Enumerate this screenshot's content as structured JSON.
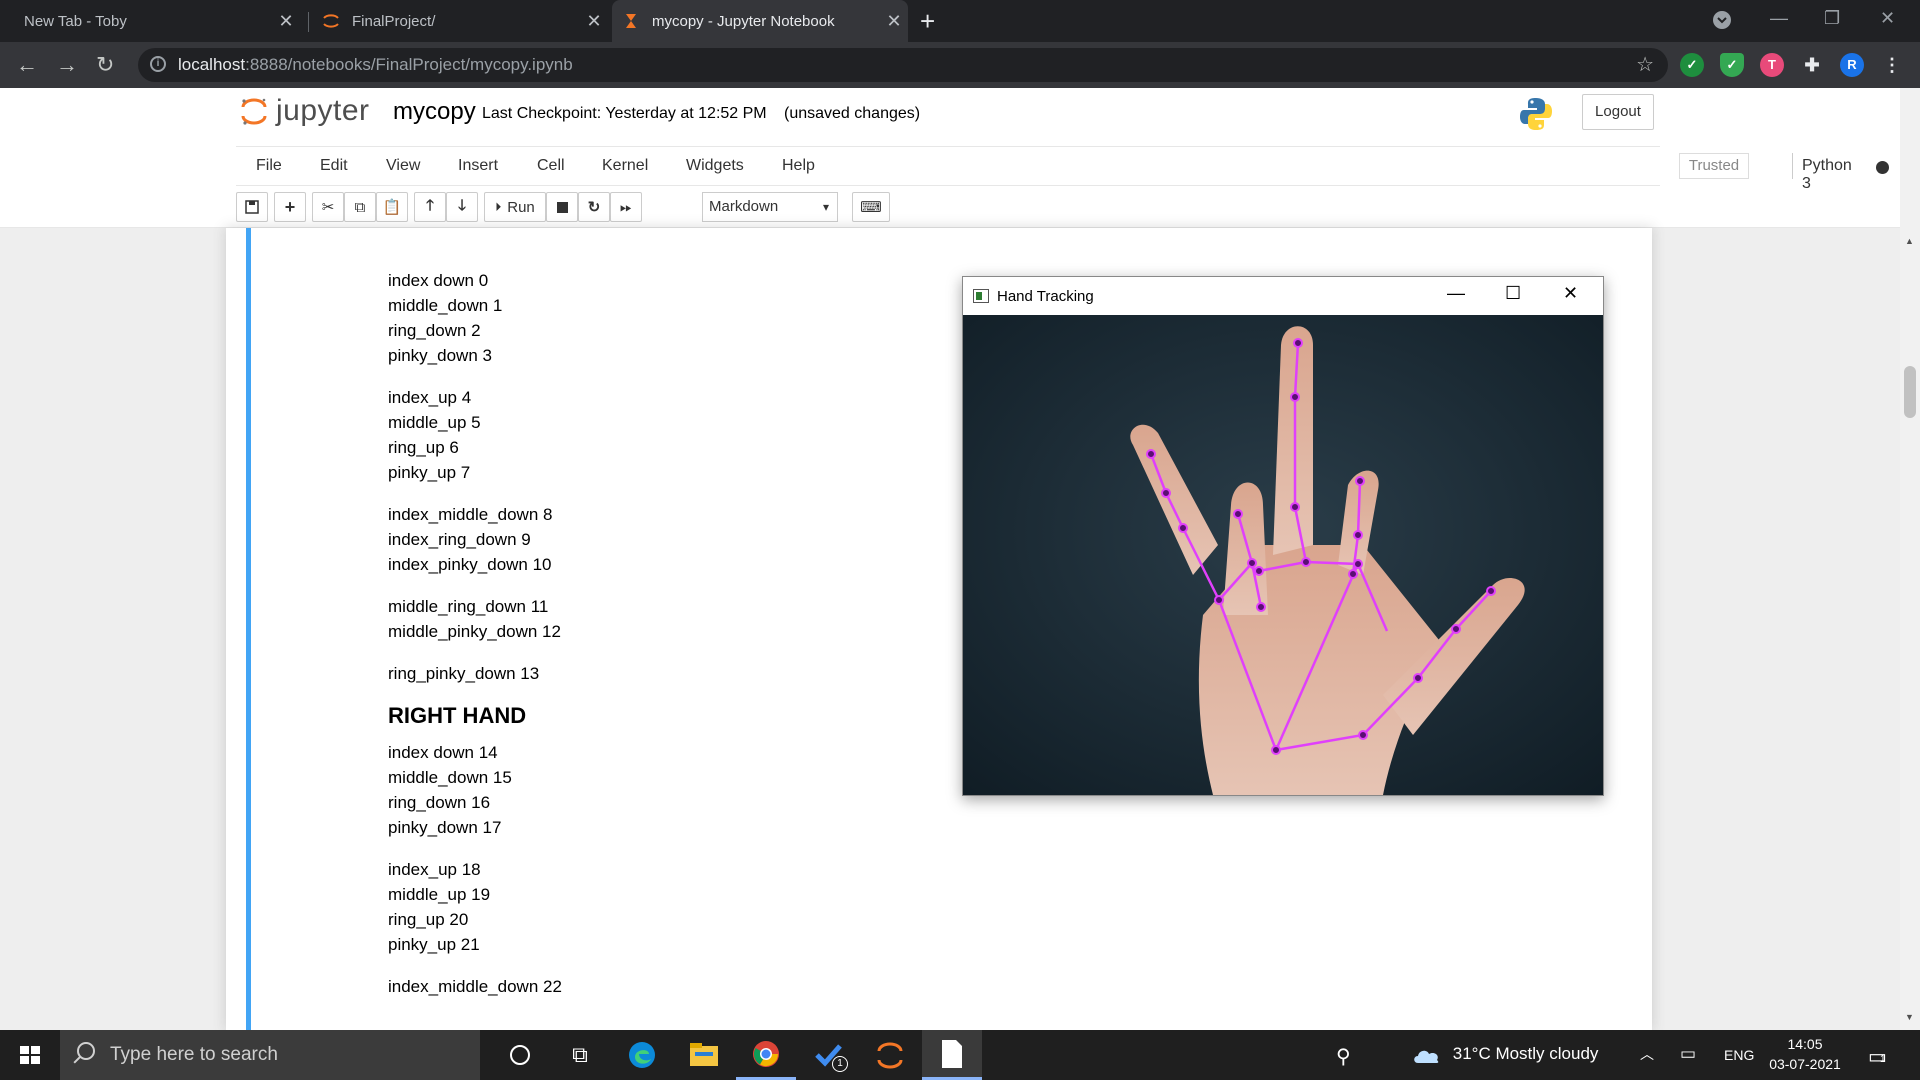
{
  "browser": {
    "tabs": [
      {
        "title": "New Tab - Toby",
        "active": false
      },
      {
        "title": "FinalProject/",
        "active": false
      },
      {
        "title": "mycopy - Jupyter Notebook",
        "active": true
      }
    ],
    "url_host": "localhost",
    "url_path": ":8888/notebooks/FinalProject/mycopy.ipynb",
    "profile_initial": "R",
    "ext_t_label": "T"
  },
  "jupyter": {
    "logo_text": "jupyter",
    "notebook_name": "mycopy",
    "checkpoint": "Last Checkpoint: Yesterday at 12:52 PM",
    "unsaved": "(unsaved changes)",
    "logout_label": "Logout",
    "menu": [
      "File",
      "Edit",
      "View",
      "Insert",
      "Cell",
      "Kernel",
      "Widgets",
      "Help"
    ],
    "trusted_label": "Trusted",
    "kernel_name": "Python 3",
    "toolbar": {
      "run_label": "Run",
      "cell_type": "Markdown"
    }
  },
  "cell": {
    "groups": [
      [
        "index down 0",
        "middle_down 1",
        "ring_down 2",
        "pinky_down 3"
      ],
      [
        "index_up 4",
        "middle_up 5",
        "ring_up 6",
        "pinky_up 7"
      ],
      [
        "index_middle_down 8",
        "index_ring_down 9",
        "index_pinky_down 10"
      ],
      [
        "middle_ring_down 11",
        "middle_pinky_down 12"
      ],
      [
        "ring_pinky_down 13"
      ]
    ],
    "heading": "RIGHT HAND",
    "groups2": [
      [
        "index down 14",
        "middle_down 15",
        "ring_down 16",
        "pinky_down 17"
      ],
      [
        "index_up 18",
        "middle_up 19",
        "ring_up 20",
        "pinky_up 21"
      ],
      [
        "index_middle_down 22"
      ]
    ]
  },
  "hand_window": {
    "title": "Hand Tracking",
    "landmark_color": "#e040fb"
  },
  "taskbar": {
    "search_placeholder": "Type here to search",
    "weather": "31°C  Mostly cloudy",
    "language": "ENG",
    "time": "14:05",
    "date": "03-07-2021",
    "notification_count": "1",
    "todo_badge": "1"
  }
}
